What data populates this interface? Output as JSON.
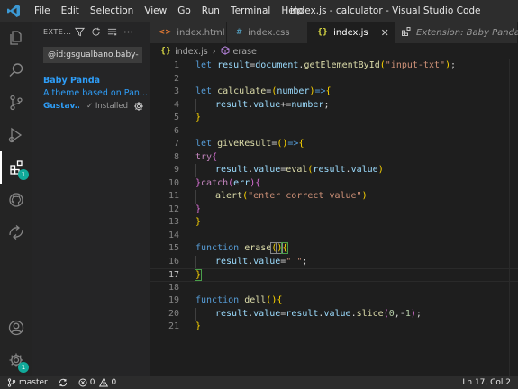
{
  "titlebar": {
    "menu": [
      "File",
      "Edit",
      "Selection",
      "View",
      "Go",
      "Run",
      "Terminal",
      "Help"
    ],
    "title": "index.js - calculator - Visual Studio Code"
  },
  "activitybar": {
    "icons": [
      "explorer-icon",
      "search-icon",
      "source-control-icon",
      "run-debug-icon",
      "extensions-icon",
      "github-icon",
      "remote-icon"
    ],
    "extensions_badge": "1",
    "settings_badge": "1"
  },
  "sidebar": {
    "title": "EXTE...",
    "search_value": "@id:gsgualbano.baby-",
    "extension": {
      "name": "Baby Panda",
      "description": "A theme based on Pan...",
      "author": "Gustav...",
      "status": "✓ Installed"
    }
  },
  "tabs": [
    {
      "icon": "<>",
      "label": "index.html",
      "icon_color": "#e37933"
    },
    {
      "icon": "#",
      "label": "index.css",
      "icon_color": "#519aba"
    },
    {
      "icon": "{}",
      "label": "index.js",
      "icon_color": "#cbcb41"
    },
    {
      "icon": "",
      "label": "Extension: Baby Panda",
      "icon_color": ""
    }
  ],
  "breadcrumb": {
    "file": "index.js",
    "symbol": "erase"
  },
  "editor": {
    "current_line": 17,
    "line_numbers": [
      "1",
      "2",
      "3",
      "4",
      "5",
      "6",
      "7",
      "8",
      "9",
      "10",
      "11",
      "12",
      "13",
      "14",
      "15",
      "16",
      "17",
      "18",
      "19",
      "20",
      "21"
    ]
  },
  "statusbar": {
    "branch": "master",
    "errors": "0",
    "warnings": "0",
    "info": "0",
    "position": "Ln 17, Col 2"
  },
  "colors": {
    "accent": "#2e9df7",
    "badge": "#11aa9a"
  }
}
